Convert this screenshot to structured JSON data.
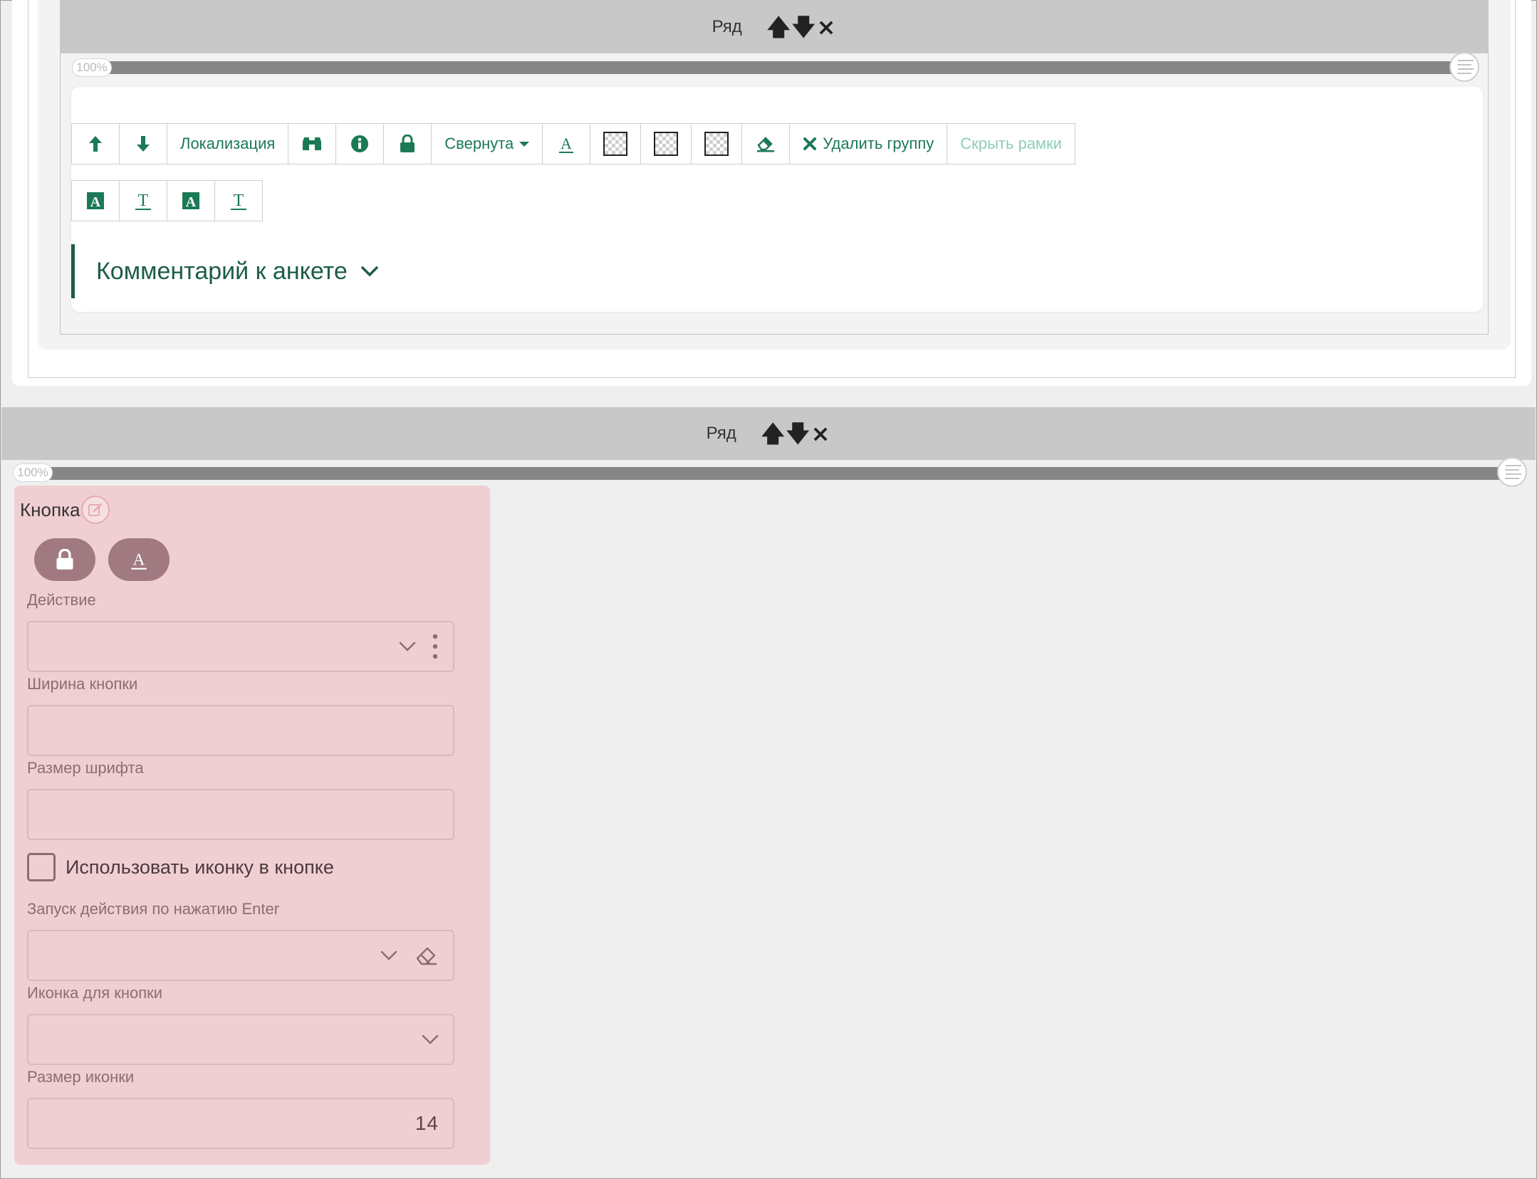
{
  "top_row": {
    "label": "Ряд",
    "controls": {
      "up": "🡅",
      "down": "🡇",
      "remove": "×"
    },
    "percent": "100%"
  },
  "group": {
    "toolbar_row1": {
      "localization": "Локализация",
      "collapsed": "Свернута",
      "delete_group": "Удалить группу",
      "hide_frames": "Скрыть рамки"
    },
    "title": "Комментарий к анкете"
  },
  "bottom_row": {
    "label": "Ряд",
    "controls": {
      "up": "🡅",
      "down": "🡇",
      "remove": "×"
    },
    "percent": "100%"
  },
  "button_widget": {
    "title": "Кнопка",
    "fields": {
      "action_label": "Действие",
      "action_value": "",
      "width_label": "Ширина кнопки",
      "width_value": "",
      "font_size_label": "Размер шрифта",
      "font_size_value": "",
      "use_icon_label": "Использовать иконку в кнопке",
      "enter_action_label": "Запуск действия по нажатию Enter",
      "enter_action_value": "",
      "icon_label": "Иконка для кнопки",
      "icon_value": "",
      "icon_size_label": "Размер иконки",
      "icon_size_value": "14"
    }
  },
  "colors": {
    "accent_green": "#1b7a55",
    "title_green": "#1b5e45",
    "row_header_gray": "#c8c8c8",
    "widget_pink": "#f0cfd3",
    "pill_mauve": "#a07a80"
  },
  "icons": [
    "arrow-up-icon",
    "arrow-down-icon",
    "binoculars-icon",
    "info-icon",
    "lock-icon",
    "text-color-icon",
    "transparency-icon",
    "eraser-icon",
    "times-icon",
    "chevron-down-icon",
    "edit-icon",
    "kebab-menu-icon",
    "lines-handle-icon"
  ]
}
